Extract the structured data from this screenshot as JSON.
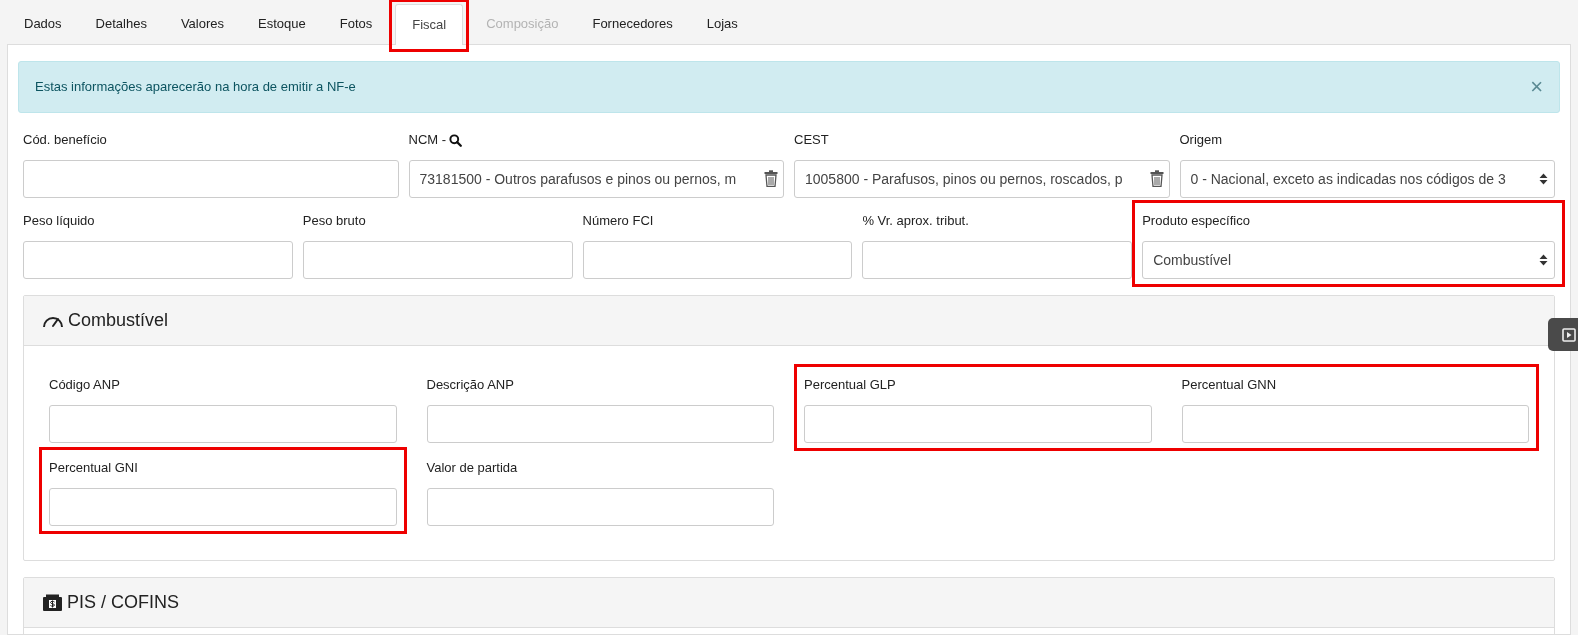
{
  "tabs": [
    {
      "label": "Dados",
      "selected": false,
      "disabled": false
    },
    {
      "label": "Detalhes",
      "selected": false,
      "disabled": false
    },
    {
      "label": "Valores",
      "selected": false,
      "disabled": false
    },
    {
      "label": "Estoque",
      "selected": false,
      "disabled": false
    },
    {
      "label": "Fotos",
      "selected": false,
      "disabled": false
    },
    {
      "label": "Fiscal",
      "selected": true,
      "disabled": false,
      "highlighted": true
    },
    {
      "label": "Composição",
      "selected": false,
      "disabled": true
    },
    {
      "label": "Fornecedores",
      "selected": false,
      "disabled": false
    },
    {
      "label": "Lojas",
      "selected": false,
      "disabled": false
    }
  ],
  "alert": {
    "text": "Estas informações aparecerão na hora de emitir a NF-e",
    "close": "×"
  },
  "fiscal_rows": [
    [
      {
        "label": "Cód. benefício",
        "kind": "text"
      },
      {
        "label": "NCM -",
        "kind": "lookup",
        "value": "73181500 - Outros parafusos e pinos ou pernos, m"
      },
      {
        "label": "CEST",
        "kind": "clearable",
        "value": "1005800 - Parafusos, pinos ou pernos, roscados, p"
      },
      {
        "label": "Origem",
        "kind": "select",
        "value": "0 - Nacional, exceto as indicadas nos códigos de 3"
      }
    ],
    [
      {
        "label": "Peso líquido",
        "kind": "text"
      },
      {
        "label": "Peso bruto",
        "kind": "text"
      },
      {
        "label": "Número FCI",
        "kind": "text"
      },
      {
        "label": "% Vr. aprox. tribut.",
        "kind": "text"
      },
      {
        "label": "Produto específico",
        "kind": "select",
        "value": "Combustível",
        "highlighted": true
      }
    ]
  ],
  "sections": [
    {
      "title": "Combustível",
      "kind": "gauge",
      "rows": [
        [
          {
            "label": "Código ANP",
            "kind": "text"
          },
          {
            "label": "Descrição ANP",
            "kind": "text"
          },
          {
            "label": "Percentual GLP",
            "kind": "text",
            "highlighted": true
          },
          {
            "label": "Percentual GNN",
            "kind": "text",
            "highlighted": true
          }
        ],
        [
          {
            "label": "Percentual GNI",
            "kind": "text",
            "highlighted": true
          },
          {
            "label": "Valor de partida",
            "kind": "text"
          }
        ]
      ]
    },
    {
      "title": "PIS / COFINS",
      "kind": "money"
    }
  ]
}
